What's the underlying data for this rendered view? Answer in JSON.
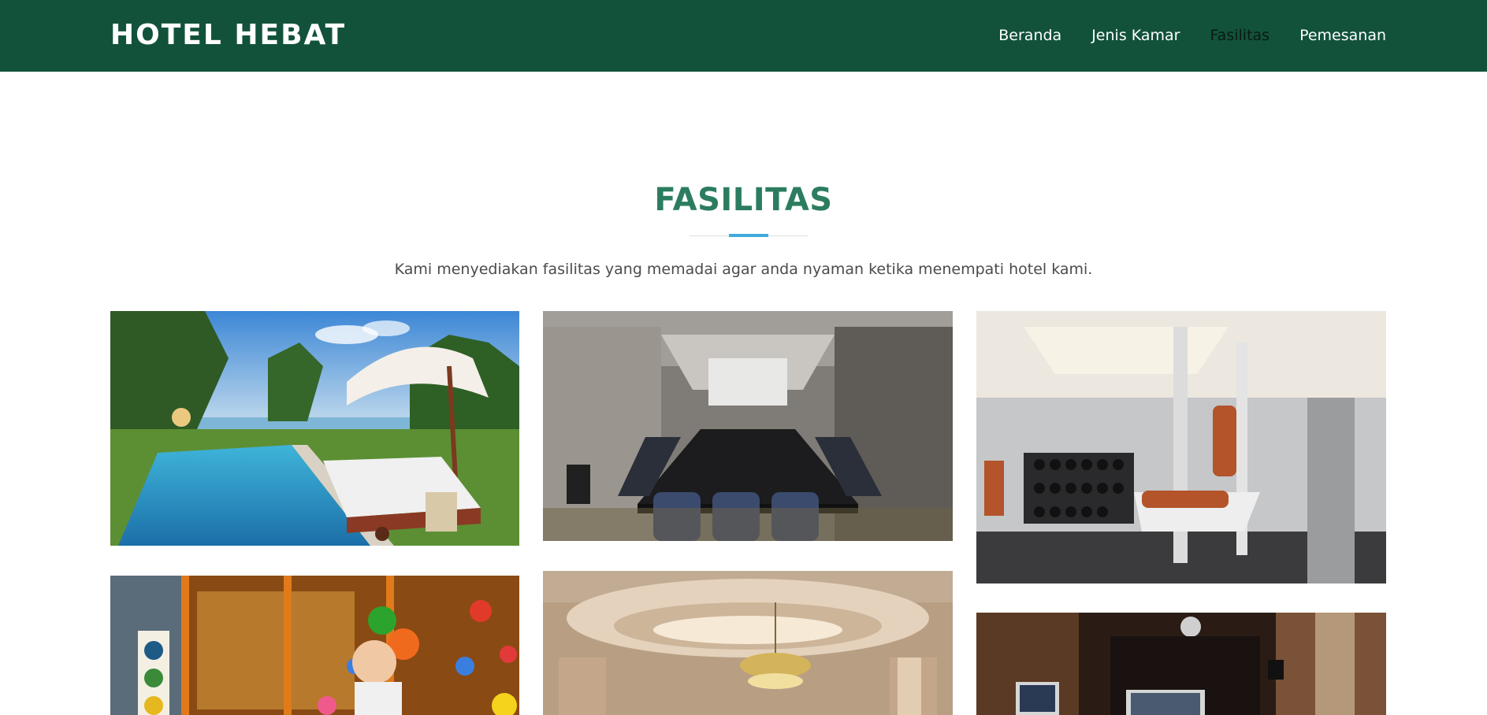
{
  "navbar": {
    "brand": "HOTEL HEBAT",
    "links": [
      {
        "label": "Beranda",
        "active": false
      },
      {
        "label": "Jenis Kamar",
        "active": false
      },
      {
        "label": "Fasilitas",
        "active": true
      },
      {
        "label": "Pemesanan",
        "active": false
      }
    ]
  },
  "section": {
    "title": "FASILITAS",
    "description": "Kami menyediakan fasilitas yang memadai agar anda nyaman ketika menempati hotel kami."
  },
  "colors": {
    "navbar_bg": "#12523b",
    "title": "#2c7d5f",
    "accent_line": "#3fa9dd"
  },
  "gallery": [
    {
      "subject": "swimming pool"
    },
    {
      "subject": "meeting room"
    },
    {
      "subject": "fitness gym"
    },
    {
      "subject": "kids playground"
    },
    {
      "subject": "ballroom"
    },
    {
      "subject": "karaoke room"
    }
  ]
}
